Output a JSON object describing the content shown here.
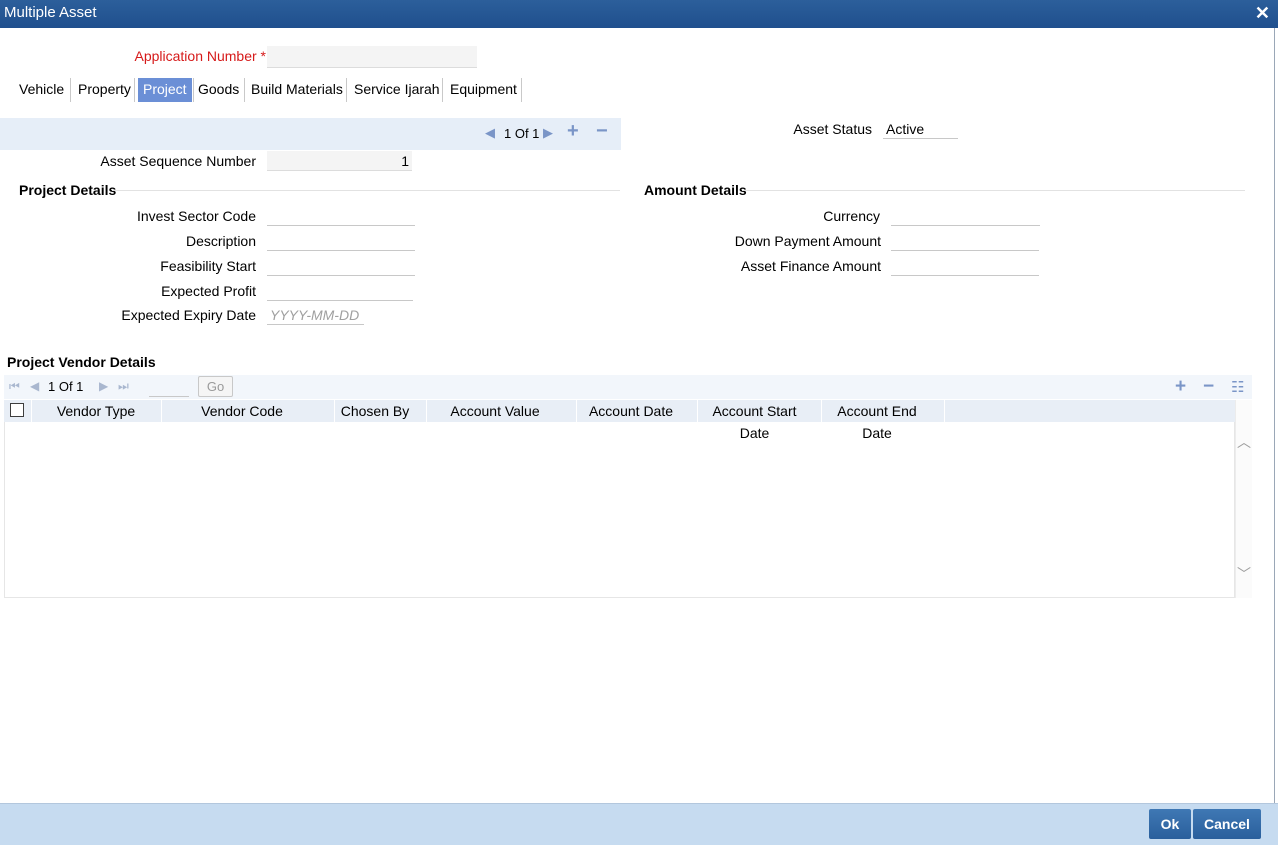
{
  "window": {
    "title": "Multiple Asset",
    "close_glyph": "✕"
  },
  "application": {
    "label": "Application Number",
    "required_mark": "*",
    "value": ""
  },
  "tabs": [
    {
      "label": "Vehicle",
      "active": false
    },
    {
      "label": "Property",
      "active": false
    },
    {
      "label": "Project",
      "active": true
    },
    {
      "label": "Goods",
      "active": false
    },
    {
      "label": "Build Materials",
      "active": false
    },
    {
      "label": "Service Ijarah",
      "active": false
    },
    {
      "label": "Equipment",
      "active": false
    }
  ],
  "asset_nav": {
    "page_text": "1 Of 1",
    "add_glyph": "+",
    "remove_glyph": "−"
  },
  "asset_status": {
    "label": "Asset Status",
    "value": "Active"
  },
  "asset_sequence": {
    "label": "Asset Sequence Number",
    "value": "1"
  },
  "project_details": {
    "title": "Project Details",
    "invest_sector_code": {
      "label": "Invest Sector Code",
      "value": ""
    },
    "description": {
      "label": "Description",
      "value": ""
    },
    "feasibility_start": {
      "label": "Feasibility Start",
      "value": ""
    },
    "expected_profit": {
      "label": "Expected Profit",
      "value": ""
    },
    "expected_expiry_date": {
      "label": "Expected Expiry Date",
      "placeholder": "YYYY-MM-DD"
    }
  },
  "amount_details": {
    "title": "Amount Details",
    "currency": {
      "label": "Currency",
      "value": ""
    },
    "down_payment_amount": {
      "label": "Down Payment Amount",
      "value": ""
    },
    "asset_finance_amount": {
      "label": "Asset Finance Amount",
      "value": ""
    }
  },
  "vendor_grid": {
    "title": "Project Vendor Details",
    "page_text": "1 Of 1",
    "go_label": "Go",
    "page_input": "",
    "columns": [
      "Vendor Type",
      "Vendor Code",
      "Chosen By",
      "Account Value",
      "Account Date",
      "Account Start Date",
      "Account End Date"
    ],
    "rows": []
  },
  "footer": {
    "ok_label": "Ok",
    "cancel_label": "Cancel"
  },
  "colors": {
    "title_bar": "#1f4f8d",
    "active_tab": "#6b8fd6",
    "required": "#d61a1a",
    "footer": "#c6dbf0"
  }
}
